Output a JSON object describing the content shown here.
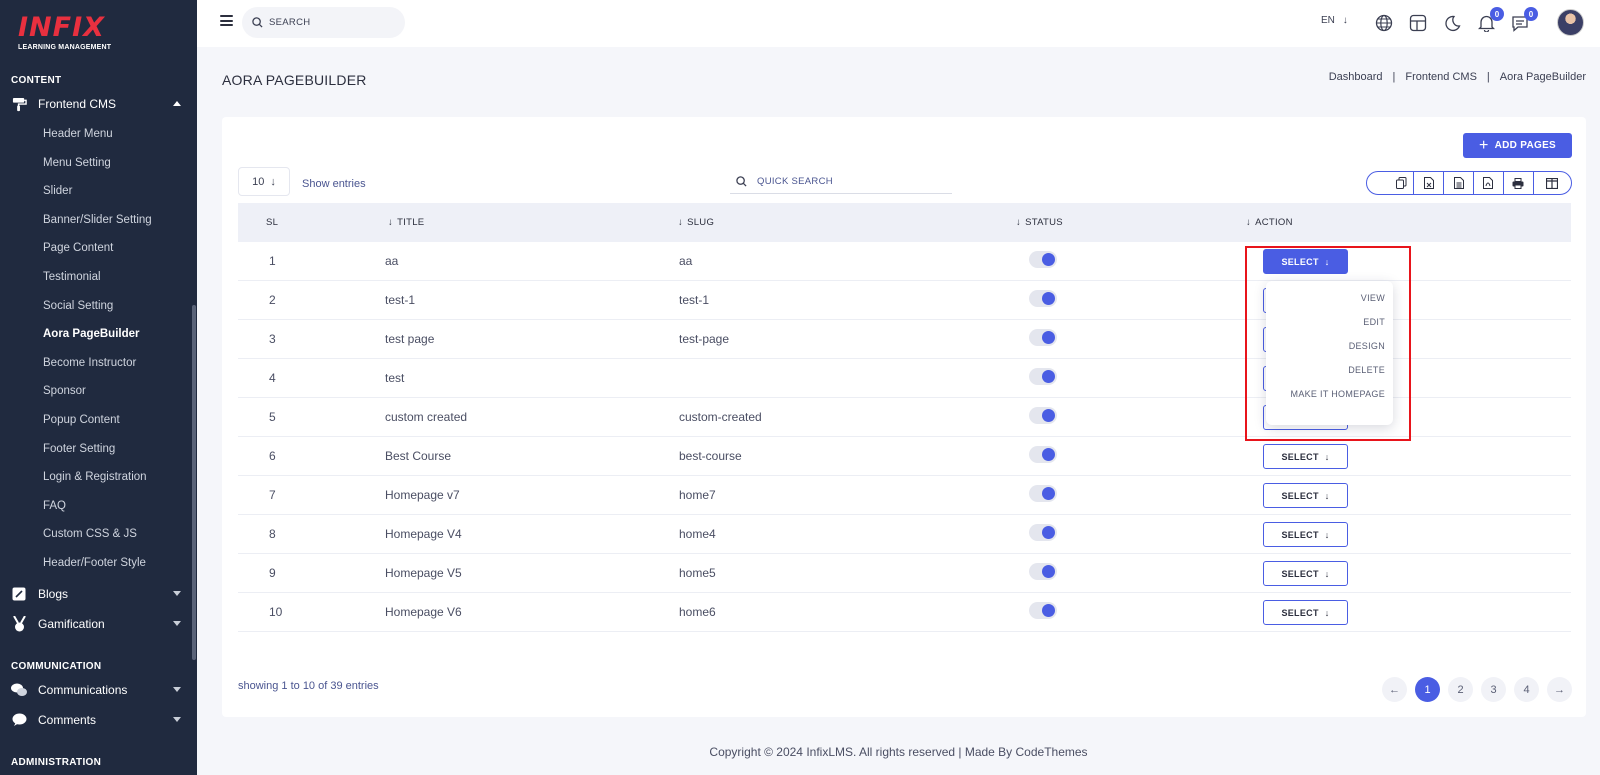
{
  "sidebar": {
    "logo": {
      "main": "INFIX",
      "sub": "LEARNING MANAGEMENT"
    },
    "content_title": "CONTENT",
    "frontend_cms": "Frontend CMS",
    "sub_items": [
      "Header Menu",
      "Menu Setting",
      "Slider",
      "Banner/Slider Setting",
      "Page Content",
      "Testimonial",
      "Social Setting",
      "Aora PageBuilder",
      "Become Instructor",
      "Sponsor",
      "Popup Content",
      "Footer Setting",
      "Login & Registration",
      "FAQ",
      "Custom CSS & JS",
      "Header/Footer Style"
    ],
    "active_item": "Aora PageBuilder",
    "blogs": "Blogs",
    "gamification": "Gamification",
    "communication_title": "COMMUNICATION",
    "communications": "Communications",
    "comments": "Comments",
    "administration_title": "ADMINISTRATION"
  },
  "topbar": {
    "search_placeholder": "SEARCH",
    "language": "EN",
    "notification_count": "0",
    "message_count": "0"
  },
  "page": {
    "title": "AORA PAGEBUILDER",
    "breadcrumb": [
      "Dashboard",
      "Frontend CMS",
      "Aora PageBuilder"
    ],
    "add_button": "ADD PAGES",
    "entries_value": "10",
    "show_entries": "Show entries",
    "quick_search_placeholder": "QUICK SEARCH"
  },
  "table": {
    "headers": {
      "sl": "SL",
      "title": "TITLE",
      "slug": "SLUG",
      "status": "STATUS",
      "action": "ACTION"
    },
    "select_label": "SELECT",
    "rows": [
      {
        "sl": "1",
        "title": "aa",
        "slug": "aa",
        "status": true
      },
      {
        "sl": "2",
        "title": "test-1",
        "slug": "test-1",
        "status": true
      },
      {
        "sl": "3",
        "title": "test page",
        "slug": "test-page",
        "status": true
      },
      {
        "sl": "4",
        "title": "test",
        "slug": "",
        "status": true
      },
      {
        "sl": "5",
        "title": "custom created",
        "slug": "custom-created",
        "status": true
      },
      {
        "sl": "6",
        "title": "Best Course",
        "slug": "best-course",
        "status": true
      },
      {
        "sl": "7",
        "title": "Homepage v7",
        "slug": "home7",
        "status": true
      },
      {
        "sl": "8",
        "title": "Homepage V4",
        "slug": "home4",
        "status": true
      },
      {
        "sl": "9",
        "title": "Homepage V5",
        "slug": "home5",
        "status": true
      },
      {
        "sl": "10",
        "title": "Homepage V6",
        "slug": "home6",
        "status": true
      }
    ]
  },
  "dropdown": {
    "items": [
      "VIEW",
      "EDIT",
      "DESIGN",
      "DELETE",
      "MAKE IT HOMEPAGE"
    ]
  },
  "pagination": {
    "showing": "showing 1 to 10 of 39 entries",
    "pages": [
      "1",
      "2",
      "3",
      "4"
    ],
    "current": "1"
  },
  "footer": {
    "text": "Copyright © 2024 InfixLMS. All rights reserved | Made By CodeThemes"
  },
  "colors": {
    "primary": "#4a5de3",
    "sidebar": "#202a3f",
    "logo": "#e8303f",
    "highlight": "#e8141b"
  }
}
